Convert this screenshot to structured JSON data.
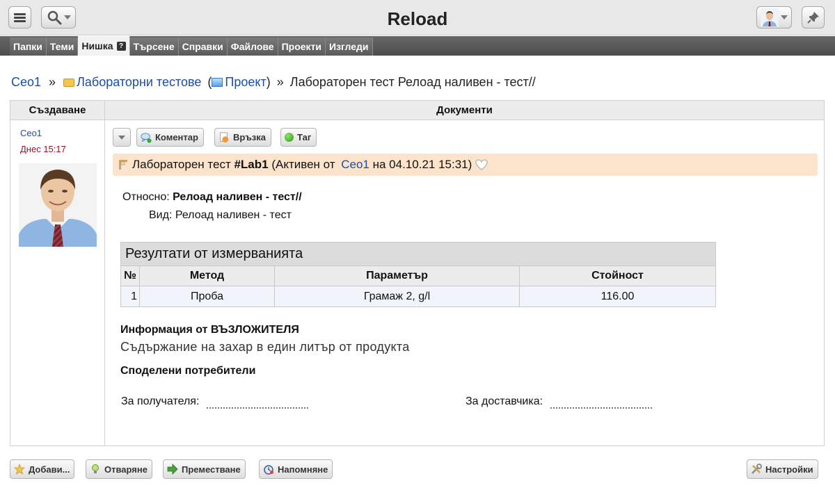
{
  "header": {
    "title": "Reload"
  },
  "tabs": [
    {
      "label": "Папки"
    },
    {
      "label": "Теми"
    },
    {
      "label": "Нишка",
      "help": "?"
    },
    {
      "label": "Търсене"
    },
    {
      "label": "Справки"
    },
    {
      "label": "Файлове"
    },
    {
      "label": "Проекти"
    },
    {
      "label": "Изгледи"
    }
  ],
  "breadcrumb": {
    "root": "Ceo1",
    "sep": "»",
    "folder": "Лабораторни тестове",
    "open_paren": "(",
    "project": "Проект",
    "close_paren": ")",
    "sep2": "»",
    "current": "Лабораторен тест Релоад наливен - тест//"
  },
  "table": {
    "col_create": "Създаване",
    "col_docs": "Документи"
  },
  "author": {
    "name": "Ceo1",
    "time": "Днес 15:17"
  },
  "toolbar": {
    "comment": "Коментар",
    "link": "Връзка",
    "tag": "Таг"
  },
  "doc": {
    "prefix": "Лабораторен тест ",
    "id": "#Lab1",
    "status_open": " (Активен от ",
    "author": "Ceo1",
    "status_close": " на 04.10.21 15:31)"
  },
  "fields": {
    "about_label": "Относно:",
    "about_value": "Релоад наливен - тест//",
    "kind_label": "Вид:",
    "kind_value": "Релоад наливен - тест"
  },
  "measurements": {
    "caption": "Резултати от измерванията",
    "headers": [
      "№",
      "Метод",
      "Параметър",
      "Стойност"
    ],
    "rows": [
      [
        "1",
        "Проба",
        "Грамаж 2, g/l",
        "116.00"
      ]
    ]
  },
  "client_info": {
    "title": "Информация от ВЪЗЛОЖИТЕЛЯ",
    "text": "Съдържание на захар в един литър от продукта"
  },
  "shared_users": {
    "title": "Споделени потребители"
  },
  "signatures": {
    "recipient": "За получателя:",
    "supplier": "За доставчика:"
  },
  "bottom": {
    "add": "Добави...",
    "open": "Отваряне",
    "move": "Преместване",
    "remind": "Напомняне",
    "settings": "Настройки"
  },
  "colors": {
    "accent_link": "#1a4fa0",
    "doc_bar": "#fbe3cc",
    "author_time": "#a0141e"
  }
}
